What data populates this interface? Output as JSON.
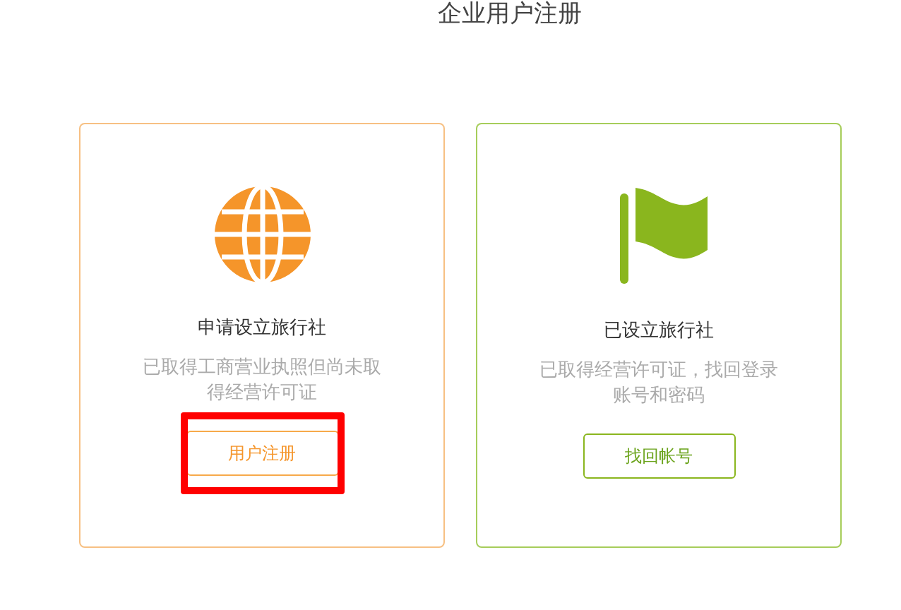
{
  "page_title": "企业用户注册",
  "cards": [
    {
      "kind": "apply",
      "heading": "申请设立旅行社",
      "description": "已取得工商营业执照但尚未取得经营许可证",
      "button": {
        "label": "用户注册",
        "highlighted": true
      }
    },
    {
      "kind": "existing",
      "heading": "已设立旅行社",
      "description": "已取得经营许可证，找回登录账号和密码",
      "button": {
        "label": "找回帐号",
        "highlighted": false
      }
    }
  ]
}
